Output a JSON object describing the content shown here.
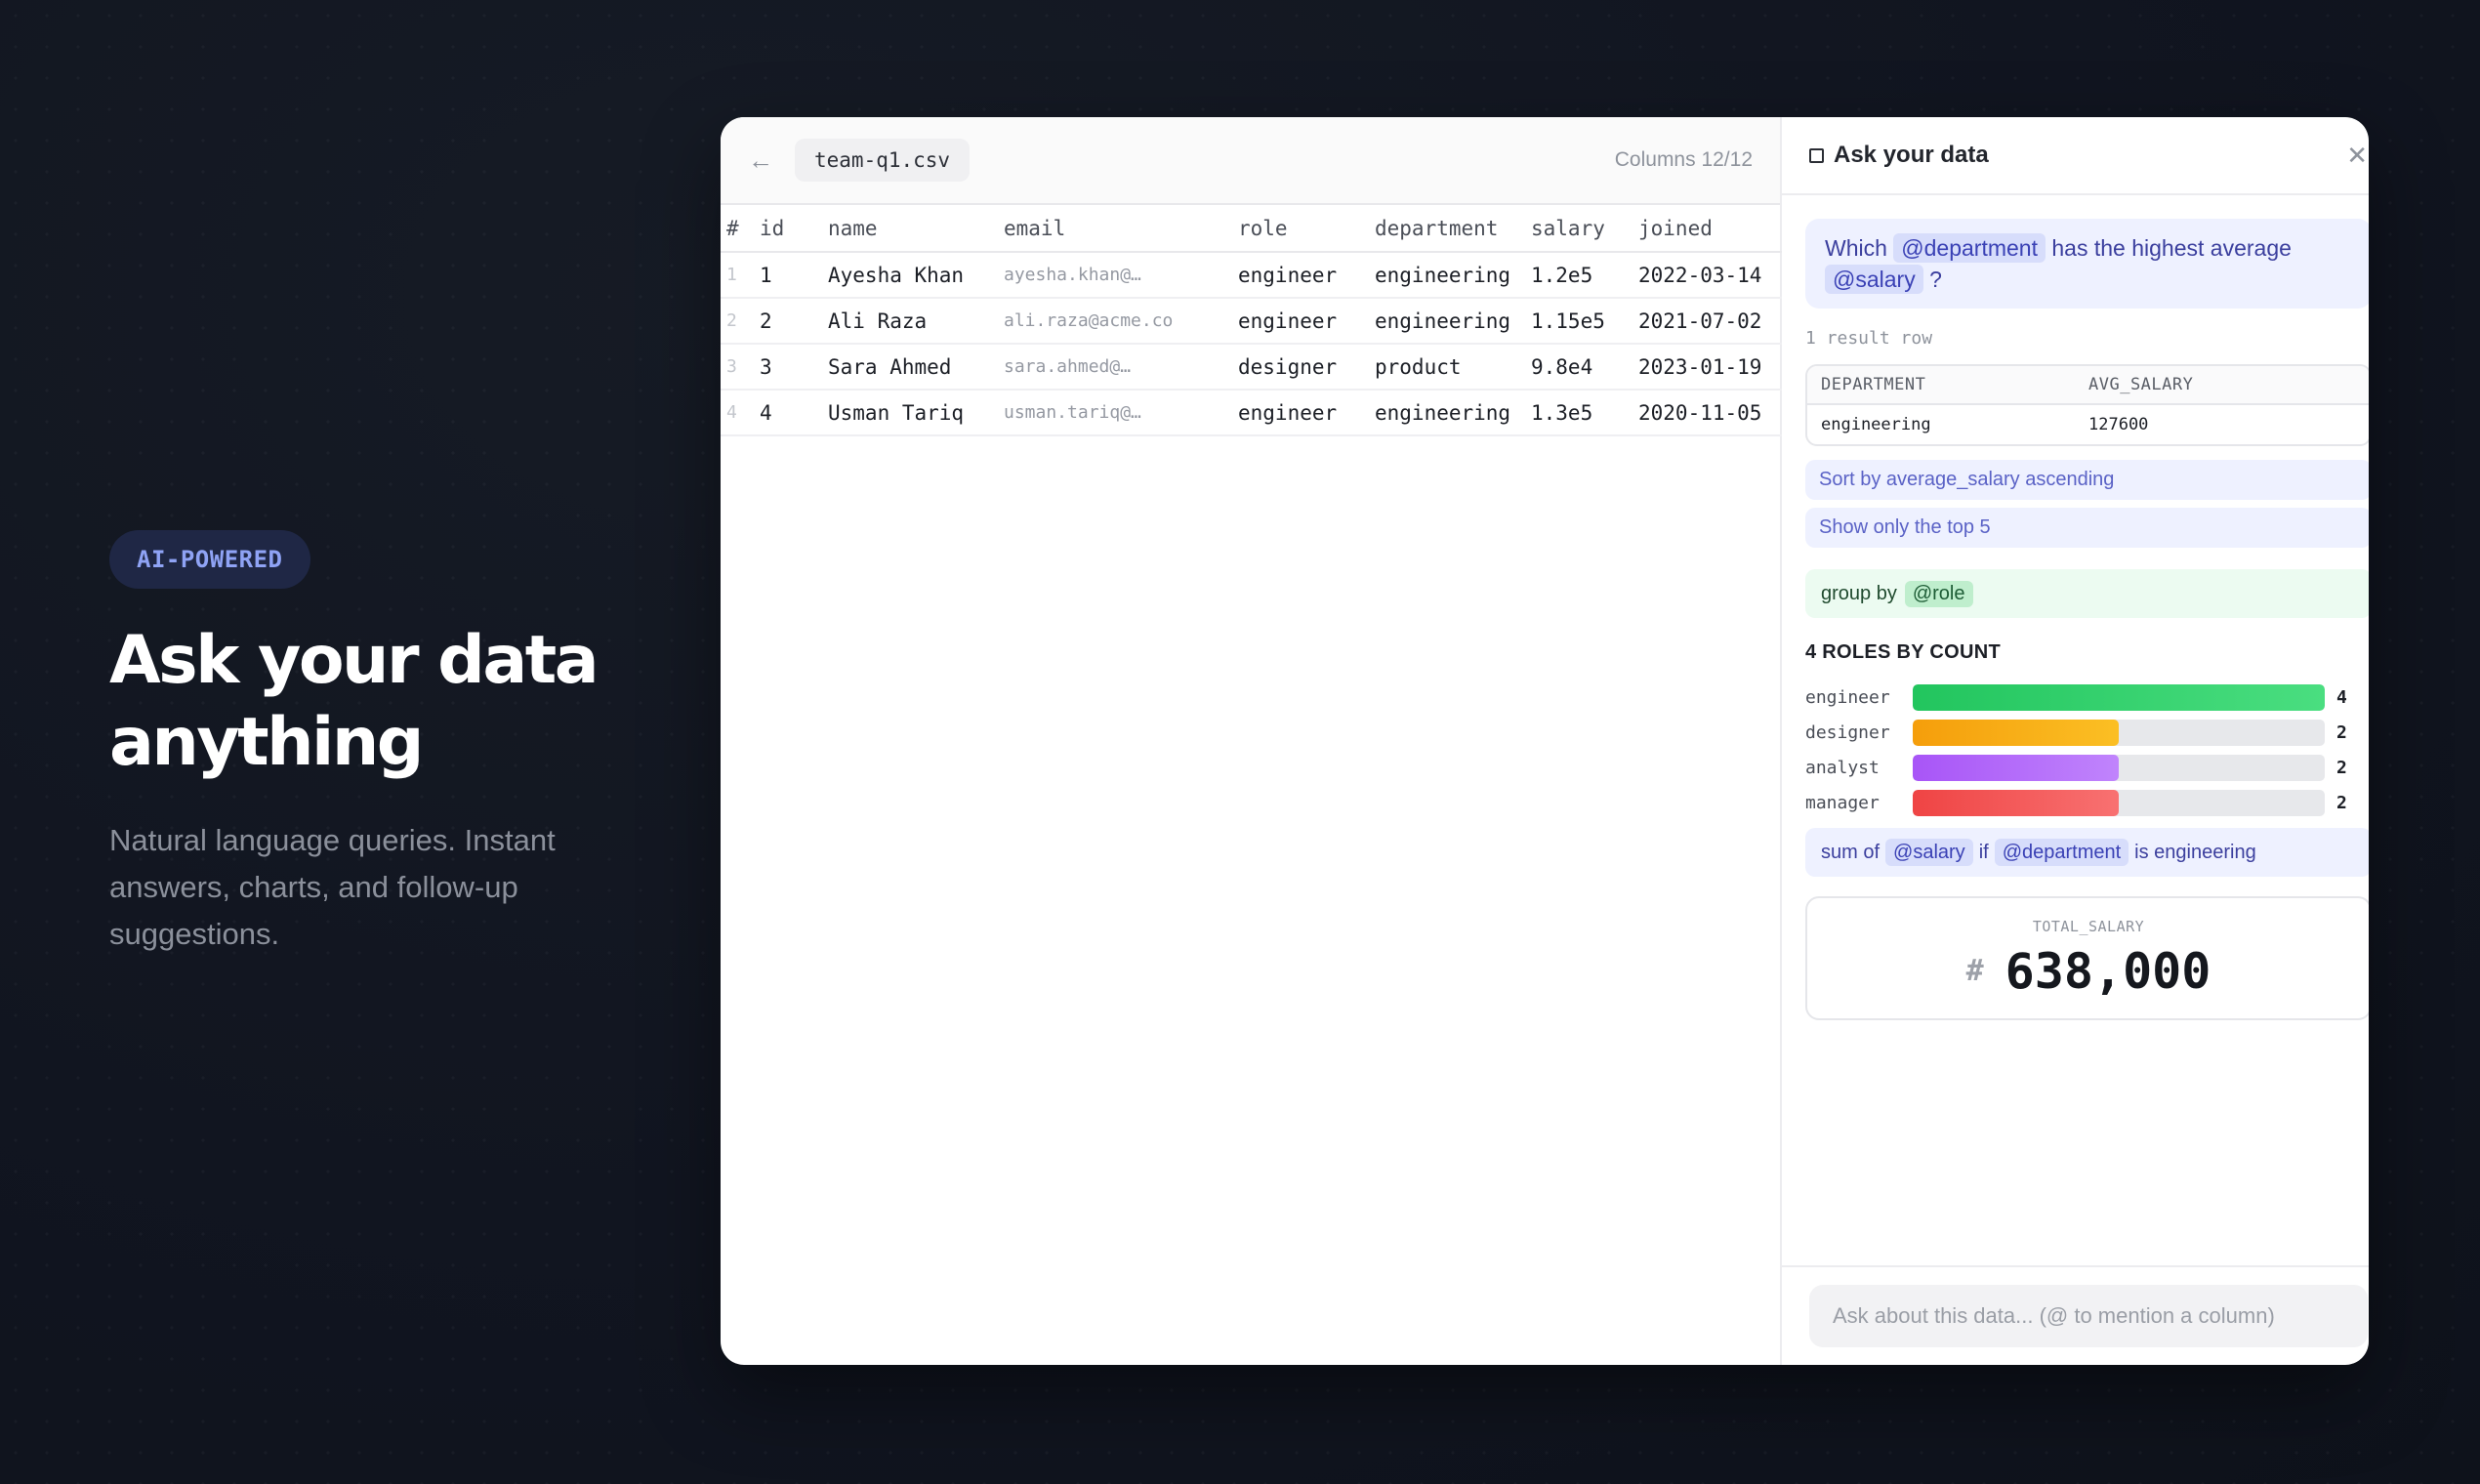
{
  "hero": {
    "badge": "AI-POWERED",
    "title": "Ask your data anything",
    "subtitle": "Natural language queries. Instant answers, charts, and follow-up suggestions."
  },
  "grid": {
    "file_name": "team-q1.csv",
    "columns_count": "Columns 12/12",
    "headers": [
      "#",
      "id",
      "name",
      "email",
      "role",
      "department",
      "salary",
      "joined"
    ],
    "rows": [
      {
        "n": "1",
        "id": "1",
        "name": "Ayesha Khan",
        "email": "ayesha.khan@…",
        "role": "engineer",
        "department": "engineering",
        "salary": "1.2e5",
        "joined": "2022-03-14"
      },
      {
        "n": "2",
        "id": "2",
        "name": "Ali Raza",
        "email": "ali.raza@acme.co",
        "role": "engineer",
        "department": "engineering",
        "salary": "1.15e5",
        "joined": "2021-07-02"
      },
      {
        "n": "3",
        "id": "3",
        "name": "Sara Ahmed",
        "email": "sara.ahmed@…",
        "role": "designer",
        "department": "product",
        "salary": "9.8e4",
        "joined": "2023-01-19"
      },
      {
        "n": "4",
        "id": "4",
        "name": "Usman Tariq",
        "email": "usman.tariq@…",
        "role": "engineer",
        "department": "engineering",
        "salary": "1.3e5",
        "joined": "2020-11-05"
      }
    ]
  },
  "chat": {
    "title": "Ask your data",
    "question": {
      "pre": "Which",
      "mention1": "@department",
      "mid": "has the highest average",
      "mention2": "@salary",
      "post": "?"
    },
    "result_count": "1 result row",
    "result_table": {
      "headers": [
        "DEPARTMENT",
        "AVG_SALARY"
      ],
      "row": [
        "engineering",
        "127600"
      ]
    },
    "suggestions": [
      "Sort by average_salary ascending",
      "Show only the top 5"
    ],
    "group_query": {
      "text": "group by",
      "mention": "@role"
    },
    "chart_title": "4 ROLES BY COUNT",
    "sum_query": {
      "pre": "sum of",
      "mention1": "@salary",
      "mid": "if",
      "mention2": "@department",
      "post": "is engineering"
    },
    "stat": {
      "label": "TOTAL_SALARY",
      "value": "638,000"
    },
    "input_placeholder": "Ask about this data... (@ to mention a column)"
  },
  "chart_data": {
    "type": "bar",
    "title": "4 ROLES BY COUNT",
    "categories": [
      "engineer",
      "designer",
      "analyst",
      "manager"
    ],
    "values": [
      4,
      2,
      2,
      2
    ],
    "xlim": [
      0,
      4
    ],
    "colors": [
      [
        "#22c55e",
        "#4ade80"
      ],
      [
        "#f59e0b",
        "#fbbf24"
      ],
      [
        "#a855f7",
        "#c084fc"
      ],
      [
        "#ef4444",
        "#f87171"
      ]
    ]
  }
}
